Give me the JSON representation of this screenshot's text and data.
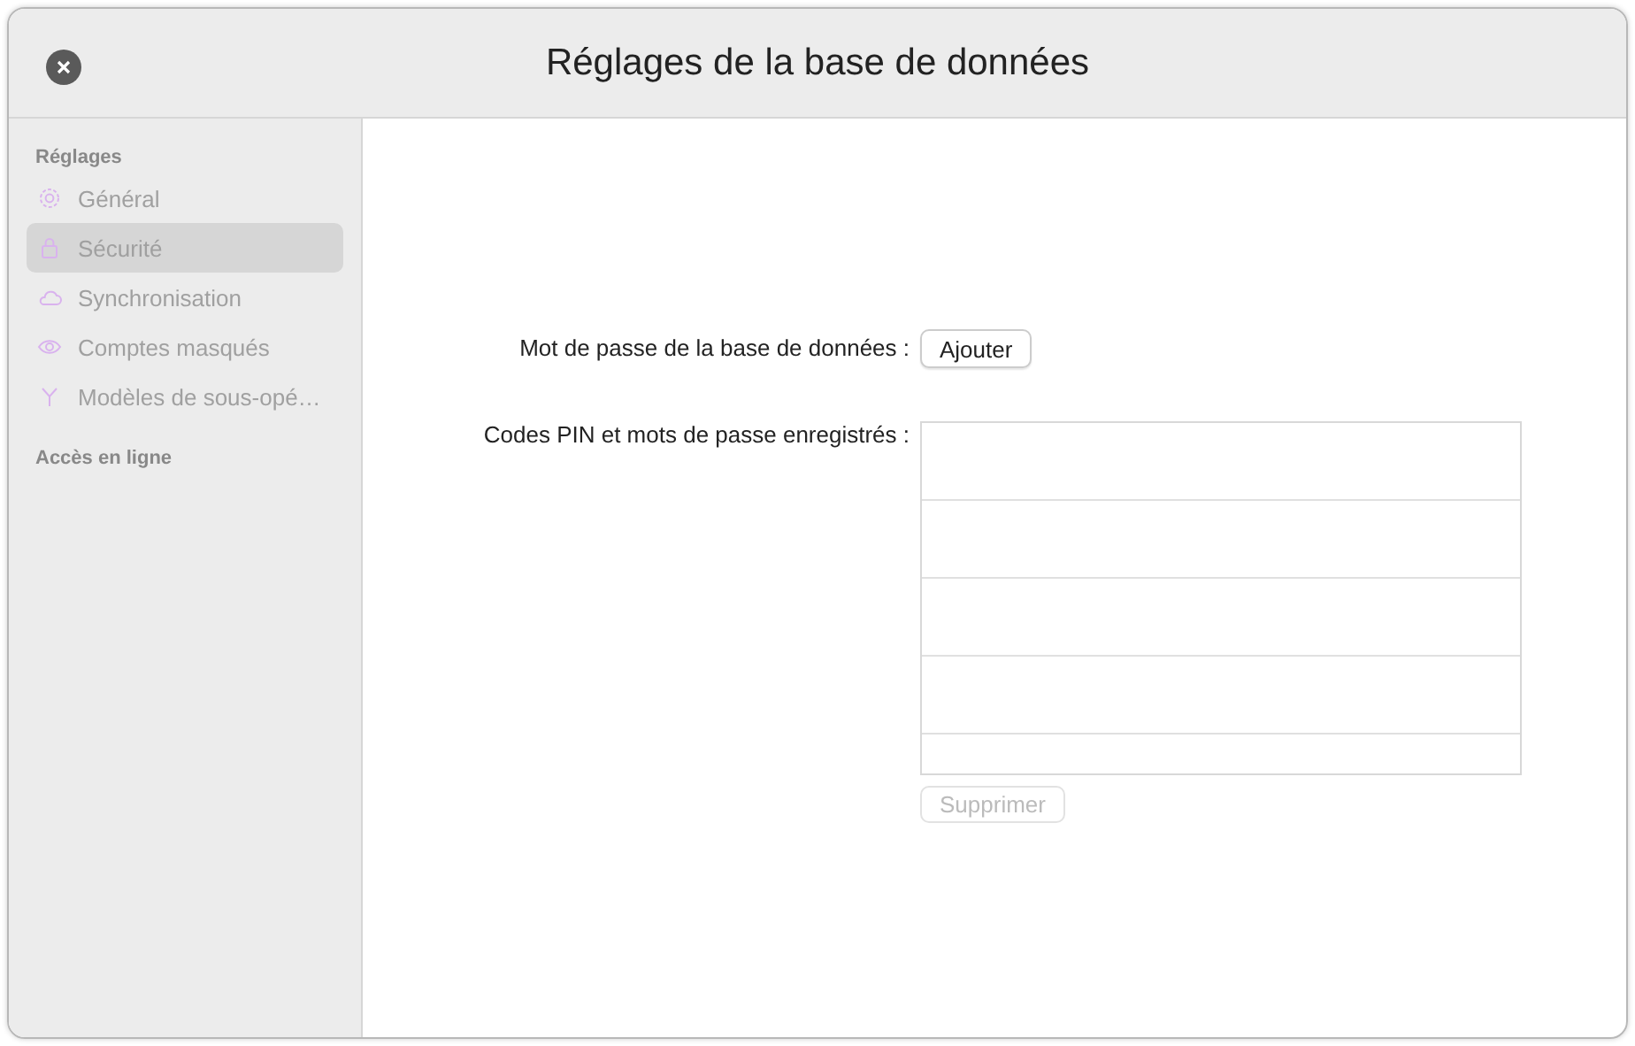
{
  "window": {
    "title": "Réglages de la base de données"
  },
  "sidebar": {
    "sections": [
      {
        "header": "Réglages",
        "items": [
          {
            "label": "Général",
            "kind": "gear",
            "selected": false,
            "disabled": true
          },
          {
            "label": "Sécurité",
            "kind": "lock",
            "selected": true,
            "disabled": true
          },
          {
            "label": "Synchronisation",
            "kind": "cloud",
            "selected": false,
            "disabled": true
          },
          {
            "label": "Comptes masqués",
            "kind": "eye",
            "selected": false,
            "disabled": true
          },
          {
            "label": "Modèles de sous-opé…",
            "kind": "fork",
            "selected": false,
            "disabled": true
          }
        ]
      },
      {
        "header": "Accès en ligne"
      }
    ]
  },
  "form": {
    "password_label": "Mot de passe de la base de données :",
    "add_button": {
      "label": "Ajouter",
      "disabled": false
    },
    "codes_label": "Codes PIN et mots de passe enregistrés :",
    "delete_button": {
      "label": "Supprimer",
      "disabled": true
    }
  }
}
